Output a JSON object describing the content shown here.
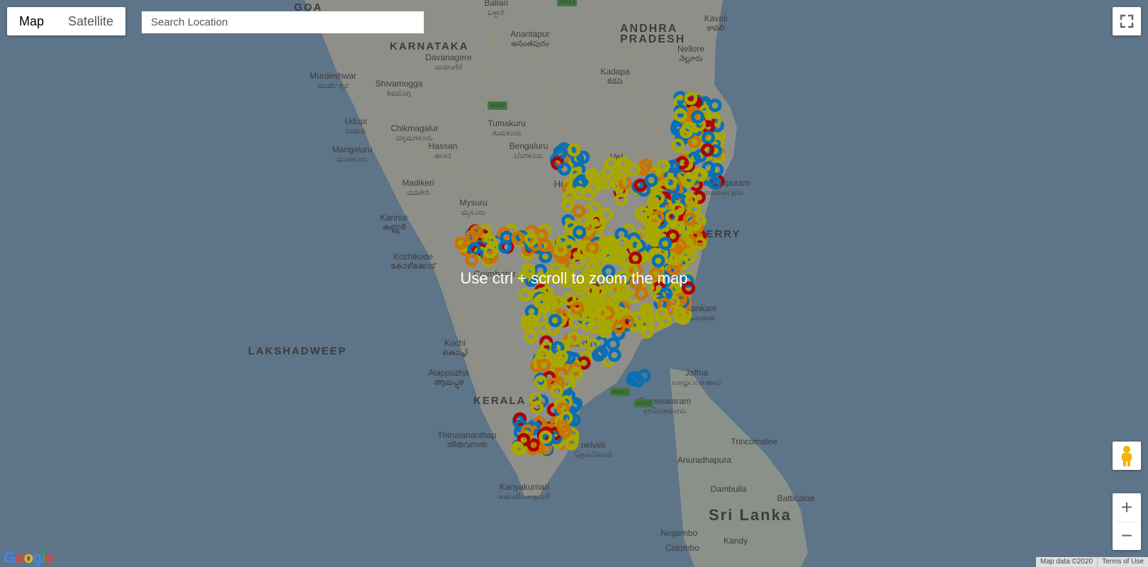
{
  "map_type": {
    "options": [
      "Map",
      "Satellite"
    ],
    "active": "Map"
  },
  "search": {
    "placeholder": "Search Location",
    "value": ""
  },
  "overlay_message": "Use ctrl + scroll to zoom the map",
  "zoom": {
    "in_label": "+",
    "out_label": "−"
  },
  "attribution": {
    "map_data": "Map data ©2020",
    "terms": "Terms of Use"
  },
  "logo_text": "Google",
  "map_labels": {
    "regions": [
      {
        "id": "goa",
        "text": "GOA"
      },
      {
        "id": "karnataka",
        "text": "KARNATAKA"
      },
      {
        "id": "andhra",
        "text": "ANDHRA"
      },
      {
        "id": "pradesh",
        "text": "PRADESH"
      },
      {
        "id": "puducherry",
        "text": "DUCHERRY"
      },
      {
        "id": "lakshadweep",
        "text": "LAKSHADWEEP"
      },
      {
        "id": "kerala",
        "text": "KERALA"
      },
      {
        "id": "srilanka",
        "text": "Sri Lanka"
      }
    ],
    "cities": [
      {
        "id": "ballari",
        "text": "Ballari",
        "native": "ಬಳ್ಳಾರಿ"
      },
      {
        "id": "kavali",
        "text": "Kavali",
        "native": "కావలి"
      },
      {
        "id": "anantapur",
        "text": "Anantapur",
        "native": "అనంతపురం"
      },
      {
        "id": "nellore",
        "text": "Nellore",
        "native": "నెల్లూరు"
      },
      {
        "id": "davanagere",
        "text": "Davanagere",
        "native": "ದಾವಣಗೆರೆ"
      },
      {
        "id": "murdeshwar",
        "text": "Murdeshwar",
        "native": "ಮುರ್ಡೇಶ್ವರ"
      },
      {
        "id": "kadapa",
        "text": "Kadapa",
        "native": "కడప"
      },
      {
        "id": "shivamogga",
        "text": "Shivamogga",
        "native": "ಶಿವಮೊಗ್ಗ"
      },
      {
        "id": "udupi",
        "text": "Udupi",
        "native": "ಉಡುಪಿ"
      },
      {
        "id": "tumakuru",
        "text": "Tumakuru",
        "native": "ತುಮಕೂರು"
      },
      {
        "id": "chikmagalur",
        "text": "Chikmagalur",
        "native": "ಚಿಕ್ಕಮಗಳೂರು"
      },
      {
        "id": "hassan",
        "text": "Hassan",
        "native": "ಹಾಸನ"
      },
      {
        "id": "bengaluru",
        "text": "Bengaluru",
        "native": "ಬೆಂಗಳೂರು"
      },
      {
        "id": "mangaluru",
        "text": "Mangaluru",
        "native": "ಮಂಗಳೂರು"
      },
      {
        "id": "madikeri",
        "text": "Madikeri",
        "native": "ಮಡಿಕೇರಿ"
      },
      {
        "id": "mysuru",
        "text": "Mysuru",
        "native": "ಮೈಸೂರು"
      },
      {
        "id": "mahabalipuram",
        "text": "Mahabalipuram",
        "native": "மாமல்லபுரம்"
      },
      {
        "id": "kannur",
        "text": "Kannur",
        "native": "കണ്ണൂർ"
      },
      {
        "id": "kozhikode",
        "text": "Kozhikode",
        "native": "കോഴിക്കോട്"
      },
      {
        "id": "kochi",
        "text": "Kochi",
        "native": "കൊച്ചി"
      },
      {
        "id": "alappuzha",
        "text": "Alappuzha",
        "native": "ആലപ്പുഴ"
      },
      {
        "id": "jaffna",
        "text": "Jaffna",
        "native": "யாழ்ப்பாணம்"
      },
      {
        "id": "rameswaram",
        "text": "Rameswaram",
        "native": "ராமேசுவரம்"
      },
      {
        "id": "thiruvananthapuram",
        "text": "Thiruvananthap",
        "native": "തിരുവനന്ത"
      },
      {
        "id": "tirunelveli",
        "text": "nelveli",
        "native": "நெல்வேலி"
      },
      {
        "id": "trincomalee",
        "text": "Trincomalee",
        "native": ""
      },
      {
        "id": "anuradhapura",
        "text": "Anuradhapura",
        "native": ""
      },
      {
        "id": "kanyakumari",
        "text": "Kanyakumari",
        "native": "கன்னியாகுமரி"
      },
      {
        "id": "dambulla",
        "text": "Dambulla",
        "native": ""
      },
      {
        "id": "batticaloa",
        "text": "Batticaloa",
        "native": ""
      },
      {
        "id": "negombo",
        "text": "Negombo",
        "native": ""
      },
      {
        "id": "kandy",
        "text": "Kandy",
        "native": ""
      },
      {
        "id": "colombo",
        "text": "Colombo",
        "native": ""
      },
      {
        "id": "kankesanthurai",
        "text": "kankani",
        "native": "ங்கனை"
      }
    ],
    "partial": [
      {
        "id": "coimbatore",
        "text": "Coimbator"
      },
      {
        "id": "madurai",
        "text": "Madu"
      },
      {
        "id": "vellore",
        "text": "Vel"
      },
      {
        "id": "ho",
        "text": "Ho"
      }
    ],
    "highways": [
      {
        "id": "ah43a",
        "text": "AH43"
      },
      {
        "id": "ah47",
        "text": "AH47"
      },
      {
        "id": "ah43b",
        "text": "AH43"
      },
      {
        "id": "ah43c",
        "text": "AH43"
      }
    ]
  },
  "marker_colors": {
    "blue": "#0a6fb5",
    "yellow": "#a8a800",
    "orange": "#c87400",
    "red": "#b00000"
  }
}
